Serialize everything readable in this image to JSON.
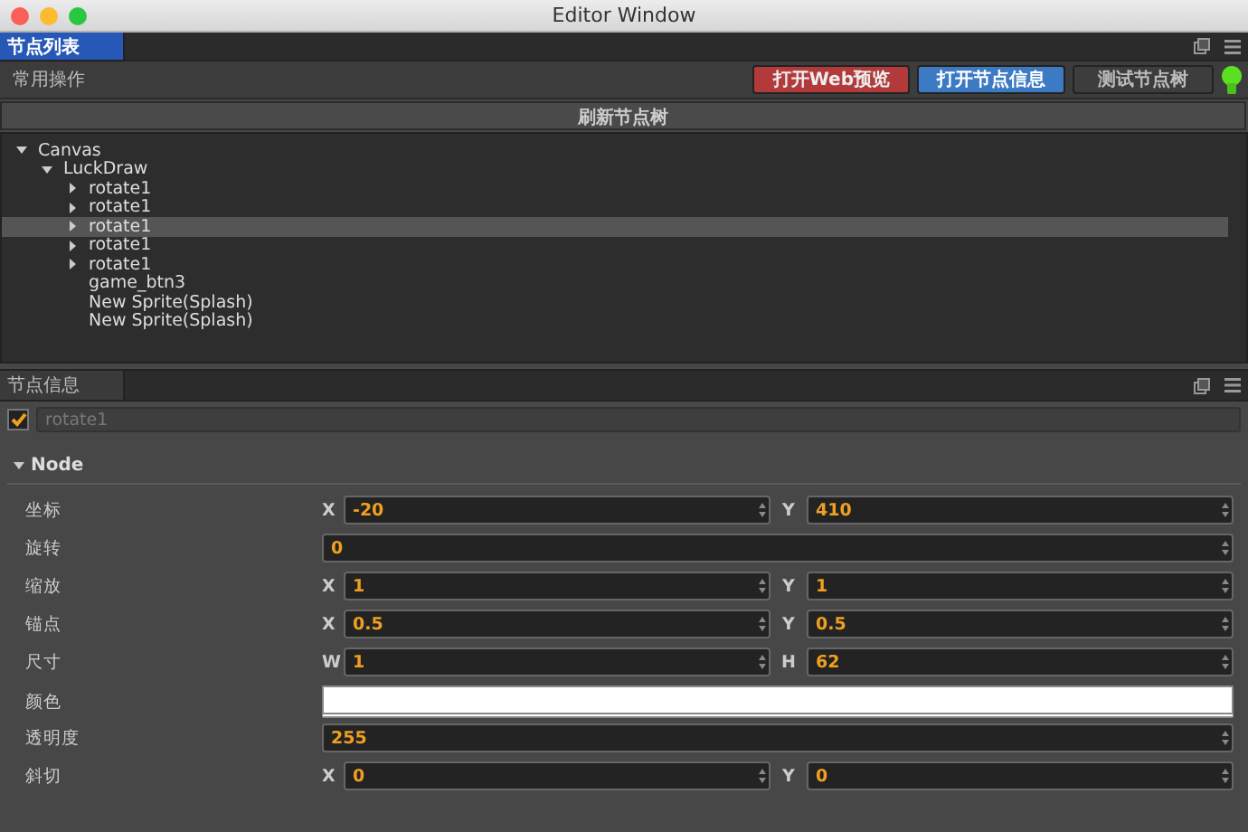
{
  "window": {
    "title": "Editor Window"
  },
  "top_panel": {
    "tab": {
      "label": "节点列表",
      "selected": true
    },
    "toolbar": {
      "label": "常用操作",
      "buttons": [
        {
          "label": "打开Web预览",
          "kind": "danger"
        },
        {
          "label": "打开节点信息",
          "kind": "primary"
        },
        {
          "label": "测试节点树",
          "kind": "default"
        }
      ],
      "status_on": true
    },
    "refresh_button": "刷新节点树",
    "tree": [
      {
        "label": "Canvas",
        "kind": "group",
        "expanded": true,
        "selected": false,
        "children": [
          {
            "label": "LuckDraw",
            "kind": "group",
            "expanded": true,
            "selected": false,
            "children": [
              {
                "label": "rotate1",
                "kind": "group",
                "expanded": false,
                "selected": false
              },
              {
                "label": "rotate1",
                "kind": "group",
                "expanded": false,
                "selected": false
              },
              {
                "label": "rotate1",
                "kind": "group",
                "expanded": false,
                "selected": true
              },
              {
                "label": "rotate1",
                "kind": "group",
                "expanded": false,
                "selected": false
              },
              {
                "label": "rotate1",
                "kind": "group",
                "expanded": false,
                "selected": false
              },
              {
                "label": "game_btn3",
                "kind": "leaf",
                "selected": false
              },
              {
                "label": "New Sprite(Splash)",
                "kind": "leaf",
                "selected": false
              },
              {
                "label": "New Sprite(Splash)",
                "kind": "leaf",
                "selected": false
              }
            ]
          }
        ]
      }
    ]
  },
  "bottom_panel": {
    "tab": {
      "label": "节点信息",
      "selected": false
    },
    "node": {
      "active": true,
      "name": "rotate1"
    },
    "section": {
      "title": "Node",
      "expanded": true
    },
    "properties": [
      {
        "label": "坐标",
        "kind": "vec2",
        "fields": [
          {
            "axis": "X",
            "value": "-20"
          },
          {
            "axis": "Y",
            "value": "410"
          }
        ]
      },
      {
        "label": "旋转",
        "kind": "number",
        "value": "0"
      },
      {
        "label": "缩放",
        "kind": "vec2",
        "fields": [
          {
            "axis": "X",
            "value": "1"
          },
          {
            "axis": "Y",
            "value": "1"
          }
        ]
      },
      {
        "label": "锚点",
        "kind": "vec2",
        "fields": [
          {
            "axis": "X",
            "value": "0.5"
          },
          {
            "axis": "Y",
            "value": "0.5"
          }
        ]
      },
      {
        "label": "尺寸",
        "kind": "vec2",
        "fields": [
          {
            "axis": "W",
            "value": "1"
          },
          {
            "axis": "H",
            "value": "62"
          }
        ]
      },
      {
        "label": "颜色",
        "kind": "color",
        "color": "#ffffff"
      },
      {
        "label": "透明度",
        "kind": "number",
        "value": "255"
      },
      {
        "label": "斜切",
        "kind": "vec2",
        "fields": [
          {
            "axis": "X",
            "value": "0"
          },
          {
            "axis": "Y",
            "value": "0"
          }
        ]
      }
    ]
  }
}
